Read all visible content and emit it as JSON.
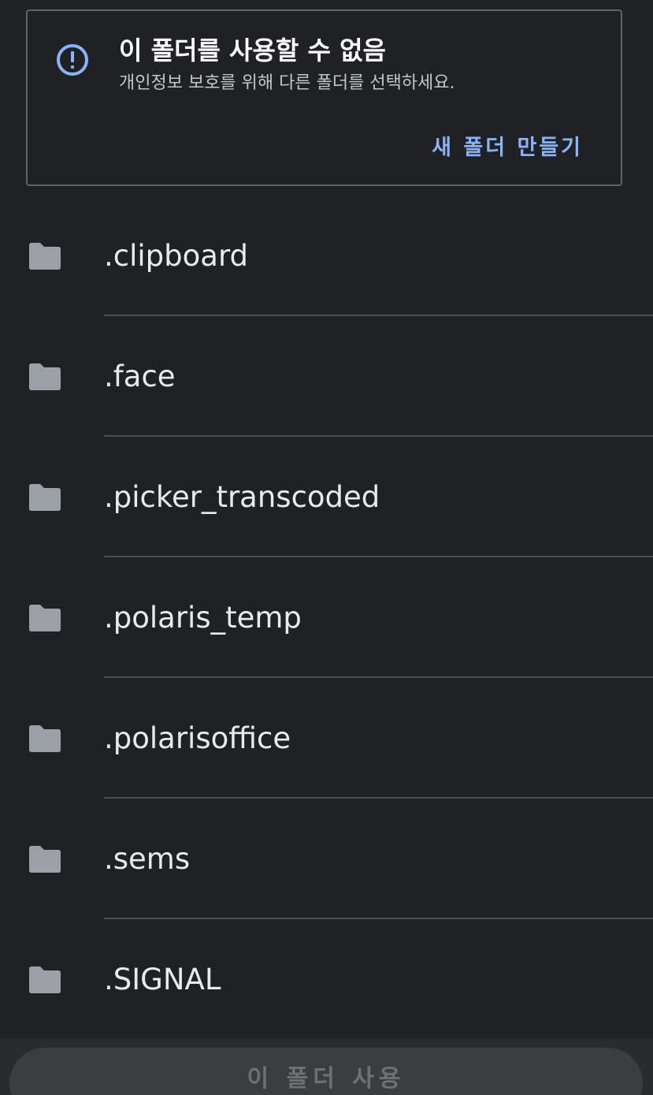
{
  "warning": {
    "title": "이 폴더를 사용할 수 없음",
    "subtitle": "개인정보 보호를 위해 다른 폴더를 선택하세요.",
    "new_folder_label": "새 폴더 만들기",
    "icon": "alert-circle-icon",
    "accent_color": "#8ab4f8"
  },
  "folders": [
    {
      "name": ".clipboard",
      "icon": "folder-icon"
    },
    {
      "name": ".face",
      "icon": "folder-icon"
    },
    {
      "name": ".picker_transcoded",
      "icon": "folder-icon"
    },
    {
      "name": ".polaris_temp",
      "icon": "folder-icon"
    },
    {
      "name": ".polarisoffice",
      "icon": "folder-icon"
    },
    {
      "name": ".sems",
      "icon": "folder-icon"
    },
    {
      "name": ".SIGNAL",
      "icon": "folder-icon"
    }
  ],
  "bottom": {
    "use_folder_label": "이 폴더 사용",
    "enabled": false
  },
  "colors": {
    "background": "#202124",
    "text": "#e8eaed",
    "folder_icon": "#9aa0a6"
  }
}
